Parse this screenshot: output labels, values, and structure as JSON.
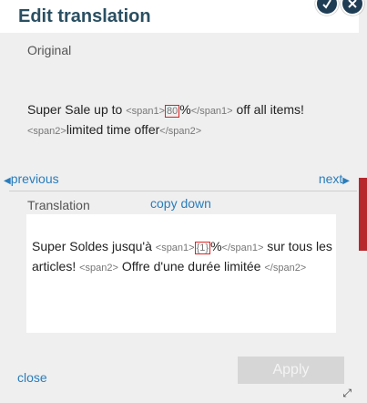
{
  "title": "Edit translation",
  "original_label": "Original",
  "original": {
    "part1": "Super Sale up to ",
    "tag_span1_open_a": "<span1>",
    "boxed_value": "80",
    "percent": "%",
    "tag_span1_close": "</span1>",
    "part2": " off all items!",
    "tag_span2_open": "<span2>",
    "part3": "limited time offer",
    "tag_span2_close": "</span2>"
  },
  "nav": {
    "previous": "previous",
    "next": "next"
  },
  "translation_label": "Translation",
  "copy_down": "copy down",
  "translation": {
    "part1": "Super Soldes jusqu'à ",
    "tag_span1_open": "<span1>",
    "boxed_value": "{1}",
    "percent": "%",
    "tag_span1_close": "</span1>",
    "part2": " sur tous les articles! ",
    "tag_span2_open": "<span2>",
    "part3": " Offre d'une durée limitée ",
    "tag_span2_close": "</span2>"
  },
  "close": "close",
  "apply": "Apply"
}
